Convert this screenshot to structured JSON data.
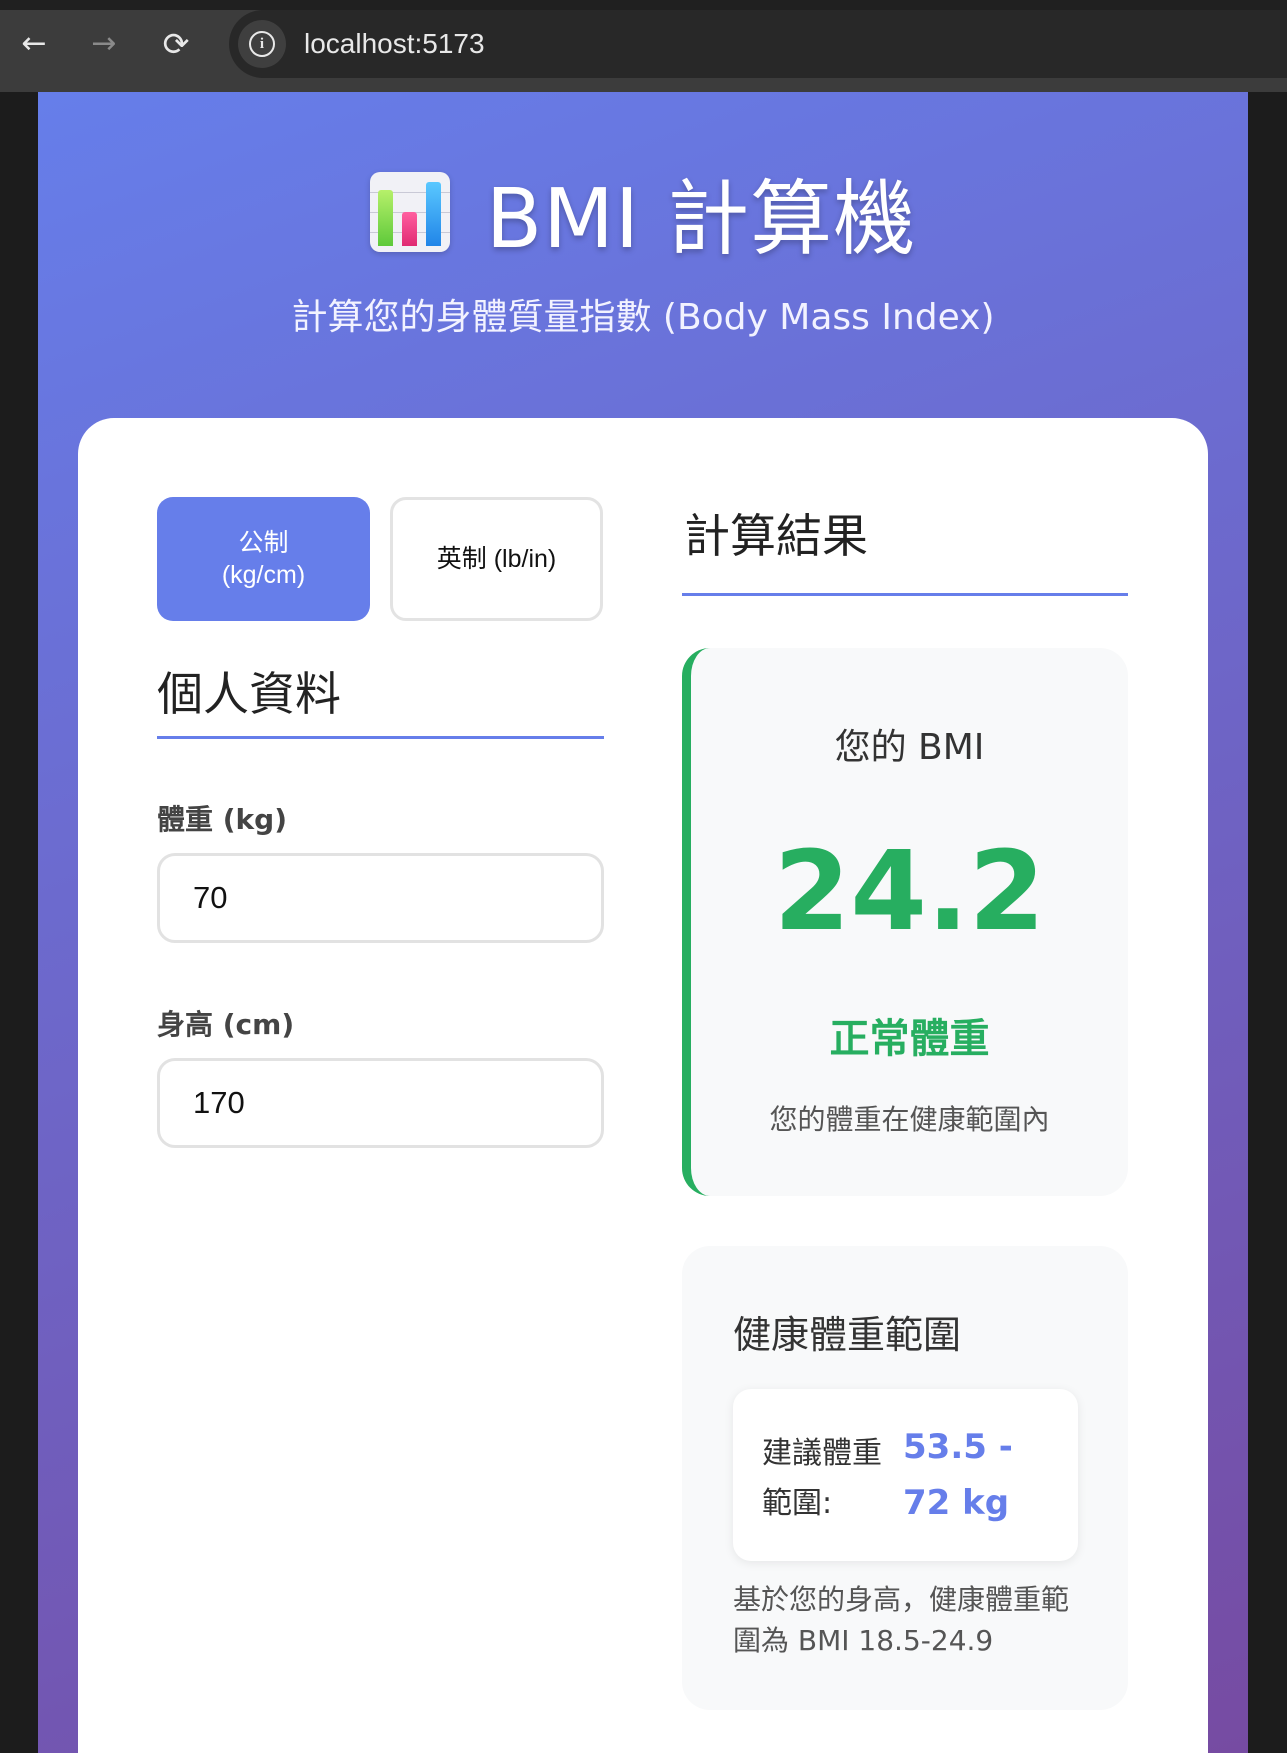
{
  "browser": {
    "url": "localhost:5173",
    "back_icon": "←",
    "forward_icon": "→",
    "reload_icon": "⟳",
    "info_icon": "i"
  },
  "header": {
    "title": "BMI 計算機",
    "subtitle": "計算您的身體質量指數 (Body Mass Index)"
  },
  "unit_toggle": {
    "metric_line1": "公制",
    "metric_line2": "(kg/cm)",
    "imperial": "英制 (lb/in)",
    "selected": "metric"
  },
  "personal_info": {
    "title": "個人資料",
    "weight_label": "體重 (kg)",
    "weight_value": "70",
    "height_label": "身高 (cm)",
    "height_value": "170"
  },
  "results": {
    "title": "計算結果",
    "bmi_label": "您的 BMI",
    "bmi_value": "24.2",
    "category": "正常體重",
    "description": "您的體重在健康範圍內",
    "category_color": "#27ae60"
  },
  "healthy_range": {
    "title": "健康體重範圍",
    "label": "建議體重範圍:",
    "value": "53.5 - 72 kg",
    "note": "基於您的身高，健康體重範圍為 BMI 18.5-24.9"
  },
  "colors": {
    "accent": "#667eea",
    "gradient_end": "#764ba2"
  }
}
